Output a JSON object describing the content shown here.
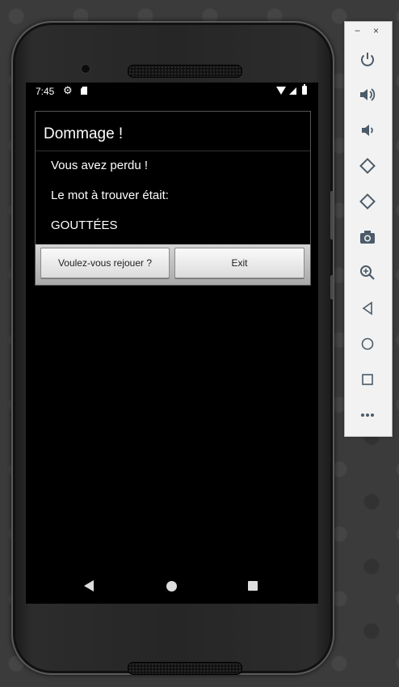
{
  "statusbar": {
    "time": "7:45"
  },
  "dialog": {
    "title": "Dommage !",
    "line1": "Vous avez perdu !",
    "line2": "Le mot à trouver était:",
    "word": "GOUTTÉES",
    "button_replay": "Voulez-vous rejouer ?",
    "button_exit": "Exit"
  },
  "toolbar": {
    "minimize": "−",
    "close": "×",
    "icons": [
      "power-icon",
      "volume-up-icon",
      "volume-down-icon",
      "rotate-left-icon",
      "rotate-right-icon",
      "camera-icon",
      "zoom-icon",
      "back-icon",
      "home-icon",
      "overview-icon",
      "more-icon"
    ]
  }
}
